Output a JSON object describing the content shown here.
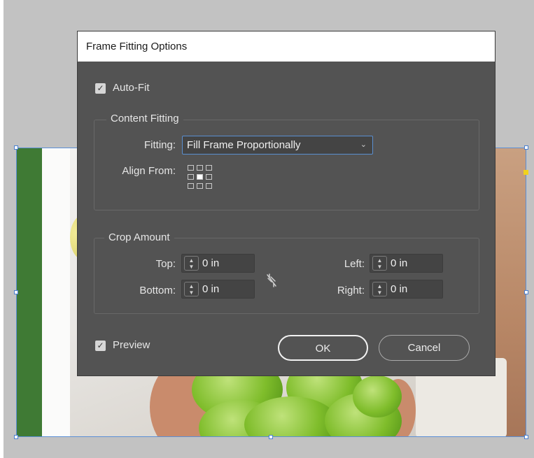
{
  "dialog": {
    "title": "Frame Fitting Options",
    "auto_fit": {
      "label": "Auto-Fit",
      "checked": true
    },
    "content_fitting": {
      "legend": "Content Fitting",
      "fitting_label": "Fitting:",
      "fitting_value": "Fill Frame Proportionally",
      "align_from_label": "Align From:",
      "align_from_selected": "center"
    },
    "crop_amount": {
      "legend": "Crop Amount",
      "top": {
        "label": "Top:",
        "value": "0 in"
      },
      "bottom": {
        "label": "Bottom:",
        "value": "0 in"
      },
      "left": {
        "label": "Left:",
        "value": "0 in"
      },
      "right": {
        "label": "Right:",
        "value": "0 in"
      },
      "link_icon": "unlinked-chain-icon"
    },
    "preview": {
      "label": "Preview",
      "checked": true
    },
    "buttons": {
      "ok": "OK",
      "cancel": "Cancel"
    }
  },
  "colors": {
    "dialog_bg": "#535353",
    "titlebar_bg": "#ffffff",
    "focus_blue": "#5a8fd0",
    "selection_blue": "#4a7fd0",
    "pasteboard": "#c2c2c2",
    "green_strip": "#3f7a34"
  }
}
